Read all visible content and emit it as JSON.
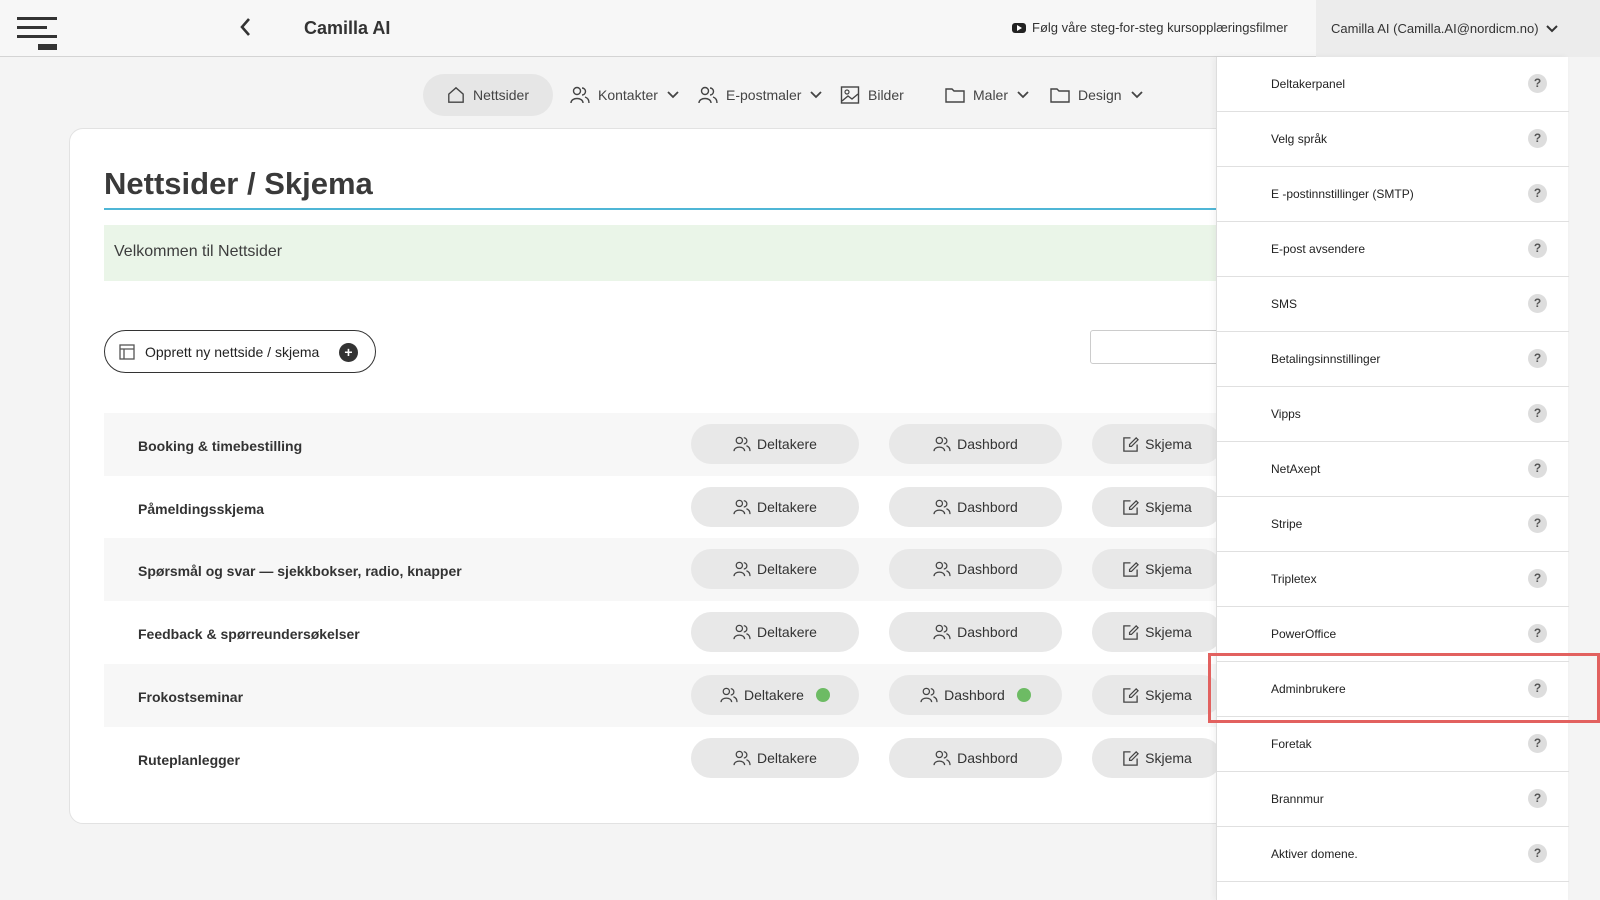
{
  "header": {
    "app_title": "Camilla AI",
    "video_link": "Følg våre steg-for-steg kursopplæringsfilmer",
    "user": "Camilla AI (Camilla.AI@nordicm.no)"
  },
  "nav": {
    "home": "Nettsider",
    "contacts": "Kontakter",
    "email_templates": "E-postmaler",
    "images": "Bilder",
    "templates": "Maler",
    "design": "Design"
  },
  "main": {
    "title": "Nettsider / Skjema",
    "welcome": "Velkommen til Nettsider",
    "create_label": "Opprett ny nettside / skjema",
    "search_placeholder": "",
    "button_labels": {
      "participants": "Deltakere",
      "dashboard": "Dashbord",
      "form": "Skjema"
    },
    "rows": [
      {
        "name": "Booking & timebestilling",
        "status_dots": false
      },
      {
        "name": "Påmeldingsskjema",
        "status_dots": false
      },
      {
        "name": "Spørsmål og svar — sjekkbokser, radio, knapper",
        "status_dots": false
      },
      {
        "name": "Feedback & spørreundersøkelser",
        "status_dots": false
      },
      {
        "name": "Frokostseminar",
        "status_dots": true
      },
      {
        "name": "Ruteplanlegger",
        "status_dots": false
      }
    ]
  },
  "dropdown": {
    "items": [
      {
        "label": "Deltakerpanel"
      },
      {
        "label": "Velg språk"
      },
      {
        "label": "E -postinnstillinger (SMTP)"
      },
      {
        "label": "E-post avsendere"
      },
      {
        "label": "SMS"
      },
      {
        "label": "Betalingsinnstillinger"
      },
      {
        "label": "Vipps"
      },
      {
        "label": "NetAxept"
      },
      {
        "label": "Stripe"
      },
      {
        "label": "Tripletex"
      },
      {
        "label": "PowerOffice"
      },
      {
        "label": "Adminbrukere"
      },
      {
        "label": "Foretak"
      },
      {
        "label": "Brannmur"
      },
      {
        "label": "Aktiver domene."
      }
    ],
    "help_glyph": "?",
    "highlighted_index": 11
  },
  "colors": {
    "accent_rule": "#4fb6d6",
    "welcome_bg": "#eaf5e8",
    "status_dot": "#6dbb64",
    "highlight_border": "#e2615f"
  }
}
